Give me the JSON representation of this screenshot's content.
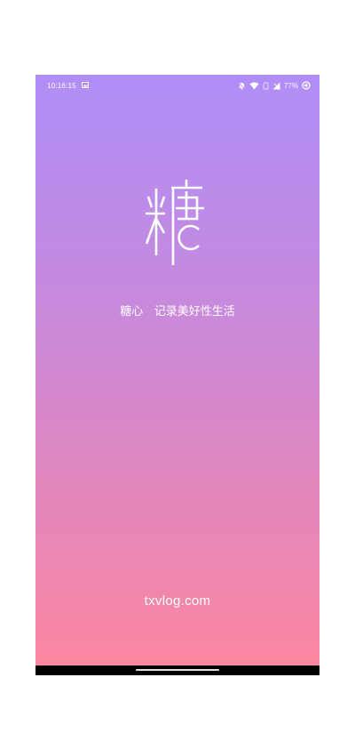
{
  "status_bar": {
    "time": "10:16:15",
    "battery": "77%",
    "icons": [
      "image-icon",
      "bell-icon",
      "wifi-icon",
      "data-icon",
      "signal-icon",
      "battery-icon"
    ]
  },
  "splash": {
    "logo_char": "糖",
    "tagline": "糖心   记录美好性生活",
    "website": "txvlog.com"
  },
  "colors": {
    "gradient_top": "#b08ef8",
    "gradient_bottom": "#fb86a0",
    "text": "#ffffff",
    "nav_bar": "#000000"
  }
}
